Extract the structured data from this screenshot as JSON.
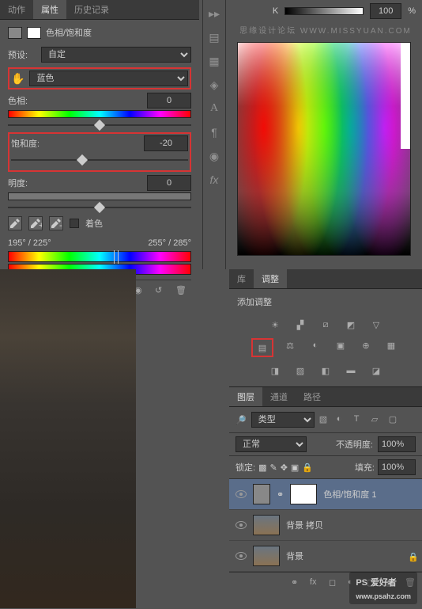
{
  "tabs": {
    "actions": "动作",
    "properties": "属性",
    "history": "历史记录"
  },
  "props": {
    "title": "色相/饱和度",
    "presetLabel": "预设:",
    "presetValue": "自定",
    "hand": "✋",
    "colorValue": "蓝色",
    "hueLabel": "色相:",
    "hueValue": "0",
    "satLabel": "饱和度:",
    "satValue": "-20",
    "lightLabel": "明度:",
    "lightValue": "0",
    "colorizeLabel": "着色",
    "rangeLeft": "195° / 225°",
    "rangeRight": "255° / 285°"
  },
  "k": {
    "label": "K",
    "value": "100",
    "pct": "%"
  },
  "watermark": "思缘设计论坛 WWW.MISSYUAN.COM",
  "libTabs": {
    "lib": "库",
    "adjust": "调整"
  },
  "adjTitle": "添加调整",
  "layerTabs": {
    "layers": "图层",
    "channels": "通道",
    "paths": "路径"
  },
  "layers": {
    "typeLabel": "类型",
    "blendValue": "正常",
    "opacityLabel": "不透明度:",
    "opacityValue": "100%",
    "lockLabel": "锁定:",
    "fillLabel": "填充:",
    "fillValue": "100%",
    "items": [
      {
        "name": "色相/饱和度 1"
      },
      {
        "name": "背景 拷贝"
      },
      {
        "name": "背景"
      }
    ]
  },
  "logo": {
    "ps": "PS",
    "text": "爱好者",
    "url": "www.psahz.com"
  }
}
